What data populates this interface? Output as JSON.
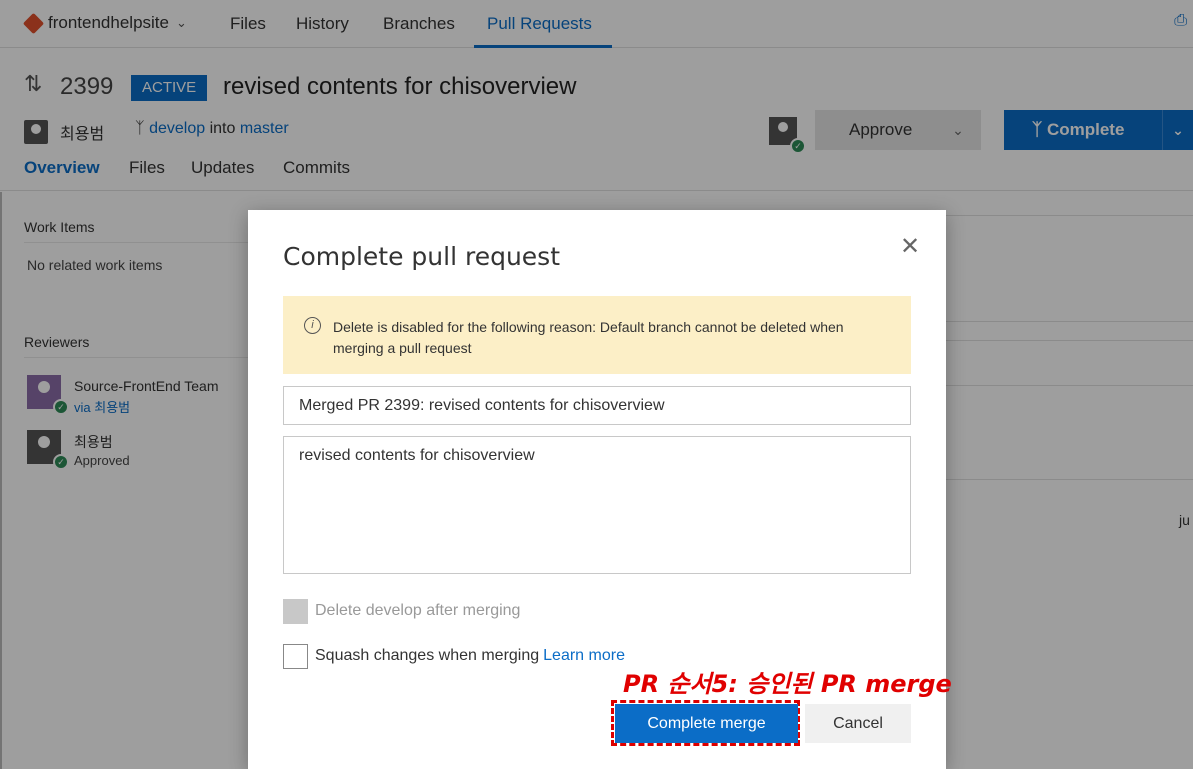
{
  "nav": {
    "repo": "frontendhelpsite",
    "items": [
      "Files",
      "History",
      "Branches",
      "Pull Requests"
    ],
    "active_index": 3
  },
  "pr": {
    "id": "2399",
    "status": "ACTIVE",
    "title": "revised contents for chisoverview",
    "author": "최용범",
    "source_branch": "develop",
    "into_text": "into",
    "target_branch": "master",
    "tabs": [
      "Overview",
      "Files",
      "Updates",
      "Commits"
    ],
    "approve_label": "Approve",
    "complete_label": "Complete"
  },
  "sidebar": {
    "work_items_heading": "Work Items",
    "work_items_empty": "No related work items",
    "reviewers_heading": "Reviewers",
    "reviewers": [
      {
        "name": "Source-FrontEnd Team",
        "sub": "via 최용범"
      },
      {
        "name": "최용범",
        "sub": "Approved"
      }
    ]
  },
  "background_fragment": "ju",
  "dialog": {
    "title": "Complete pull request",
    "warning": "Delete is disabled for the following reason: Default branch cannot be deleted when merging a pull request",
    "merge_title": "Merged PR 2399: revised contents for chisoverview",
    "merge_description": "revised contents for chisoverview",
    "delete_branch_label": "Delete develop after merging",
    "squash_label": "Squash changes when merging",
    "learn_more": "Learn more",
    "complete_merge": "Complete merge",
    "cancel": "Cancel"
  },
  "annotation": "PR 순서5: 승인된 PR merge",
  "colors": {
    "accent": "#0b6dc7",
    "warning_bg": "#fcefc7",
    "annotation": "#e00000"
  }
}
